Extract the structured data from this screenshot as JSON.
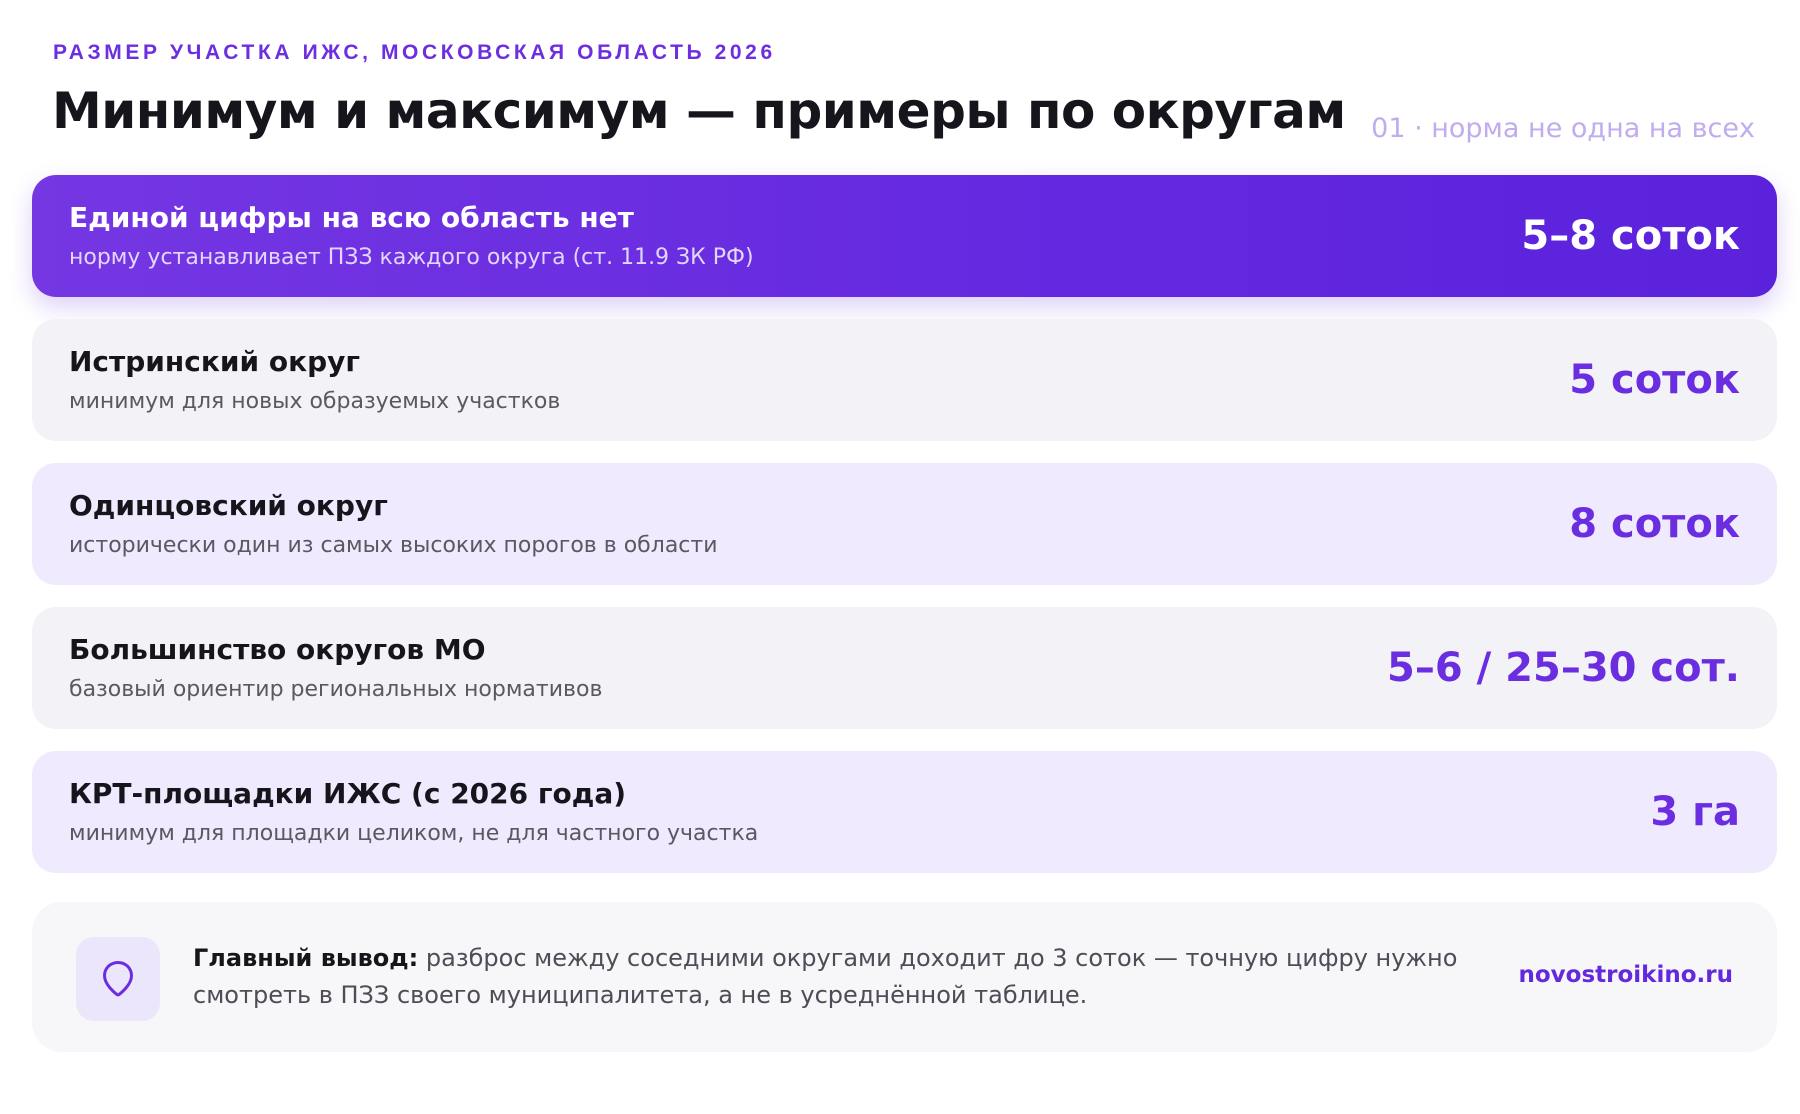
{
  "header": {
    "eyebrow": "РАЗМЕР УЧАСТКА ИЖС, МОСКОВСКАЯ ОБЛАСТЬ 2026",
    "title": "Минимум и максимум — примеры по округам",
    "side_note": "01 · норма не одна на всех"
  },
  "rows": [
    {
      "label": "Единой цифры на всю область нет",
      "sub": "норму устанавливает ПЗЗ каждого округа (ст. 11.9 ЗК РФ)",
      "value": "5–8 соток",
      "style": "hero"
    },
    {
      "label": "Истринский округ",
      "sub": "минимум для новых образуемых участков",
      "value": "5 соток",
      "style": "gray"
    },
    {
      "label": "Одинцовский округ",
      "sub": "исторически один из самых высоких порогов в области",
      "value": "8 соток",
      "style": "lilac"
    },
    {
      "label": "Большинство округов МО",
      "sub": "базовый ориентир региональных нормативов",
      "value": "5–6 / 25–30 сот.",
      "style": "gray"
    },
    {
      "label": "КРТ-площадки ИЖС (с 2026 года)",
      "sub": "минимум для площадки целиком, не для частного участка",
      "value": "3 га",
      "style": "lilac"
    }
  ],
  "takeaway": {
    "icon": "map-pin-icon",
    "lead": "Главный вывод:",
    "text": " разброс между соседними округами доходит до 3 соток — точную цифру нужно смотреть в ПЗЗ своего муниципалитета, а не в усреднённой таблице.",
    "site": "novostroikino.ru"
  },
  "colors": {
    "accent": "#6a2ee0",
    "hero_gradient_start": "#7537e2",
    "hero_gradient_end": "#5b22dc",
    "row_gray": "#f3f2f6",
    "row_lilac": "#efeafd"
  }
}
